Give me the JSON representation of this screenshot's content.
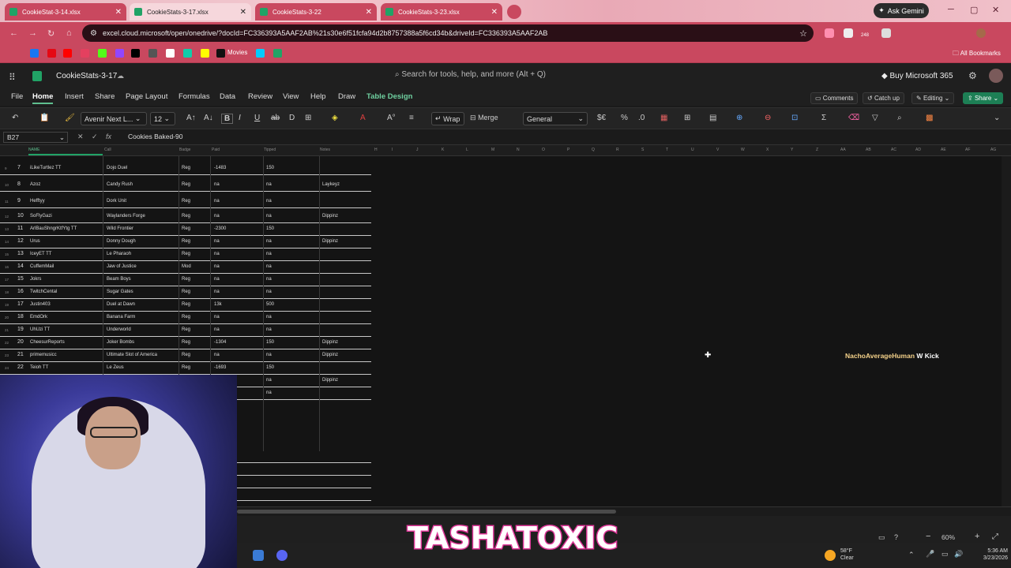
{
  "browser": {
    "tabs": [
      {
        "label": "CookieStat-3-14.xlsx"
      },
      {
        "label": "CookieStats-3-17.xlsx"
      },
      {
        "label": "CookieStats-3-22"
      },
      {
        "label": "CookieStats-3-23.xlsx"
      }
    ],
    "ask_gemini": "Ask Gemini",
    "url": "excel.cloud.microsoft/open/onedrive/?docId=FC336393A5AAF2AB%21s30e6f51fcfa94d2b8757388a5f6cd34b&driveId=FC336393A5AAF2AB",
    "ext_badge": "248",
    "bookmarks_movies": "Movies",
    "all_bookmarks": "All Bookmarks"
  },
  "excel": {
    "file_name": "CookieStats-3-17",
    "search_placeholder": "Search for tools, help, and more (Alt + Q)",
    "buy": "Buy Microsoft 365",
    "ribbon_tabs": [
      "File",
      "Home",
      "Insert",
      "Share",
      "Page Layout",
      "Formulas",
      "Data",
      "Review",
      "View",
      "Help",
      "Draw",
      "Table Design"
    ],
    "comments": "Comments",
    "catch_up": "Catch up",
    "editing": "Editing",
    "share": "Share",
    "font_name": "Avenir Next L...",
    "font_size": "12",
    "wrap": "Wrap",
    "merge": "Merge",
    "number_format": "General",
    "name_box": "B27",
    "fx_label": "fx",
    "formula": "Cookies Baked-90",
    "col_letters": [
      "H",
      "I",
      "J",
      "K",
      "L",
      "M",
      "N",
      "O",
      "P",
      "Q",
      "R",
      "S",
      "T",
      "U",
      "V",
      "W",
      "X",
      "Y",
      "Z",
      "AA",
      "AB",
      "AC",
      "AD",
      "AE",
      "AF",
      "AG"
    ],
    "header_labels": [
      "NAME",
      "Call",
      "Badge",
      "Paid",
      "Tipped",
      "Notes"
    ],
    "rows": [
      {
        "sub": "9",
        "n": "7",
        "name": "iLikeTurtlez TT",
        "call": "Dojo Duel",
        "badge": "Reg",
        "paid": "-1483",
        "tipped": "150",
        "notes": ""
      },
      {
        "sub": "10",
        "n": "8",
        "name": "Azoz",
        "call": "Candy Rush",
        "badge": "Reg",
        "paid": "na",
        "tipped": "na",
        "notes": "Laykeyz"
      },
      {
        "sub": "11",
        "n": "9",
        "name": "Hefftyy",
        "call": "Dork Unit",
        "badge": "Reg",
        "paid": "na",
        "tipped": "na",
        "notes": ""
      },
      {
        "sub": "12",
        "n": "10",
        "name": "SoFlyGazi",
        "call": "Waylanders Forge",
        "badge": "Reg",
        "paid": "na",
        "tipped": "na",
        "notes": "Dippinz"
      },
      {
        "sub": "13",
        "n": "11",
        "name": "ArlBauShngrKtfYtg TT",
        "call": "Wild Frontier",
        "badge": "Reg",
        "paid": "-2300",
        "tipped": "150",
        "notes": ""
      },
      {
        "sub": "14",
        "n": "12",
        "name": "Urus",
        "call": "Donny Dough",
        "badge": "Reg",
        "paid": "na",
        "tipped": "na",
        "notes": "Dippinz"
      },
      {
        "sub": "15",
        "n": "13",
        "name": "IceyET TT",
        "call": "Le Pharaoh",
        "badge": "Reg",
        "paid": "na",
        "tipped": "na",
        "notes": ""
      },
      {
        "sub": "16",
        "n": "14",
        "name": "CuffemMail",
        "call": "Jaw of Justice",
        "badge": "Mod",
        "paid": "na",
        "tipped": "na",
        "notes": ""
      },
      {
        "sub": "17",
        "n": "15",
        "name": "Jokrs",
        "call": "Beam Boys",
        "badge": "Reg",
        "paid": "na",
        "tipped": "na",
        "notes": ""
      },
      {
        "sub": "18",
        "n": "16",
        "name": "TwitchCental",
        "call": "Sugar Gates",
        "badge": "Reg",
        "paid": "na",
        "tipped": "na",
        "notes": ""
      },
      {
        "sub": "19",
        "n": "17",
        "name": "Justin403",
        "call": "Duel at Dawn",
        "badge": "Reg",
        "paid": "13k",
        "tipped": "500",
        "notes": ""
      },
      {
        "sub": "20",
        "n": "18",
        "name": "EmdOrk",
        "call": "Banana Farm",
        "badge": "Reg",
        "paid": "na",
        "tipped": "na",
        "notes": ""
      },
      {
        "sub": "21",
        "n": "19",
        "name": "UhUzi TT",
        "call": "Underworld",
        "badge": "Reg",
        "paid": "na",
        "tipped": "na",
        "notes": ""
      },
      {
        "sub": "22",
        "n": "20",
        "name": "CheesurReports",
        "call": "Joker Bombs",
        "badge": "Reg",
        "paid": "-1304",
        "tipped": "150",
        "notes": "Dippinz"
      },
      {
        "sub": "23",
        "n": "21",
        "name": "primemusicc",
        "call": "Ultimate Slot of America",
        "badge": "Reg",
        "paid": "na",
        "tipped": "na",
        "notes": "Dippinz"
      },
      {
        "sub": "24",
        "n": "22",
        "name": "Teioh TT",
        "call": "Le Zeus",
        "badge": "Reg",
        "paid": "-1693",
        "tipped": "150",
        "notes": ""
      },
      {
        "sub": "",
        "n": "",
        "name": "",
        "call": "",
        "badge": "",
        "paid": "",
        "tipped": "na",
        "notes": "Dippinz"
      },
      {
        "sub": "",
        "n": "",
        "name": "",
        "call": "",
        "badge": "",
        "paid": "",
        "tipped": "na",
        "notes": ""
      }
    ],
    "zoom": "60%"
  },
  "stream": {
    "chat_name": "NachoAverageHuman",
    "chat_msg": "W Kick",
    "brand": "TASHATOXIC"
  },
  "taskbar": {
    "temp": "58°F",
    "condition": "Clear",
    "time": "5:36 AM",
    "date": "3/23/2026"
  },
  "colors": {
    "accent_green": "#21a366",
    "browser_chrome": "#c9485f",
    "brand_outline": "#e0389a"
  }
}
